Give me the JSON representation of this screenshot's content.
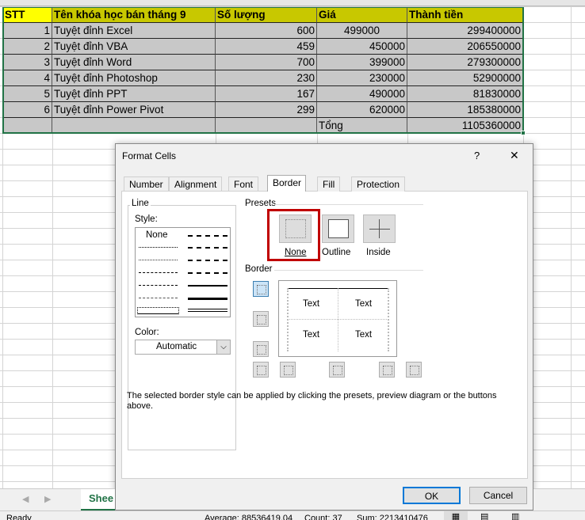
{
  "sheet": {
    "headers": [
      "STT",
      "Tên khóa học bán tháng 9",
      "Số lượng",
      "Giá",
      "Thành tiền"
    ],
    "rows": [
      [
        "1",
        "Tuyệt đỉnh Excel",
        "600",
        "499000",
        "299400000"
      ],
      [
        "2",
        "Tuyệt đỉnh VBA",
        "459",
        "450000",
        "206550000"
      ],
      [
        "3",
        "Tuyệt đỉnh Word",
        "700",
        "399000",
        "279300000"
      ],
      [
        "4",
        "Tuyệt đỉnh Photoshop",
        "230",
        "230000",
        "52900000"
      ],
      [
        "5",
        "Tuyệt đỉnh PPT",
        "167",
        "490000",
        "81830000"
      ],
      [
        "6",
        "Tuyệt đỉnh Power Pivot",
        "299",
        "620000",
        "185380000"
      ]
    ],
    "total_label": "Tổng",
    "total_value": "1105360000",
    "sheet_tab": "Shee"
  },
  "dialog": {
    "title": "Format Cells",
    "help": "?",
    "close": "✕",
    "tabs": [
      "Number",
      "Alignment",
      "Font",
      "Border",
      "Fill",
      "Protection"
    ],
    "line_label": "Line",
    "style_label": "Style:",
    "style_none": "None",
    "color_label": "Color:",
    "color_value": "Automatic",
    "presets_label": "Presets",
    "presets": [
      "None",
      "Outline",
      "Inside"
    ],
    "border_label": "Border",
    "preview_text": "Text",
    "hint": "The selected border style can be applied by clicking the presets, preview diagram or the buttons above.",
    "ok": "OK",
    "cancel": "Cancel"
  },
  "status": {
    "ready": "Ready",
    "average": "Average: 88536419.04",
    "count": "Count: 37",
    "sum": "Sum: 2213410476"
  },
  "colors": {
    "header": "#c8c800",
    "stt_header": "#ffff00",
    "selected_preset": "#c00000"
  }
}
